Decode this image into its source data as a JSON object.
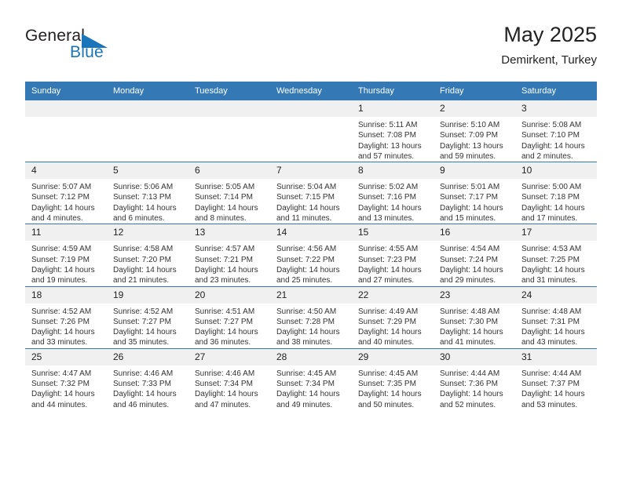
{
  "brand": {
    "name_part1": "General",
    "name_part2": "Blue",
    "accent_color": "#1b75bb",
    "triangle_icon": "triangle-right-icon"
  },
  "header": {
    "title": "May 2025",
    "subtitle": "Demirkent, Turkey"
  },
  "theme": {
    "header_bg": "#3478b5",
    "daynum_bg": "#f0f0f0",
    "grid_line": "#3478b5",
    "text": "#222222"
  },
  "weekday_headers": [
    "Sunday",
    "Monday",
    "Tuesday",
    "Wednesday",
    "Thursday",
    "Friday",
    "Saturday"
  ],
  "weeks": [
    [
      {
        "day": "",
        "sunrise": "",
        "sunset": "",
        "daylight_line1": "",
        "daylight_line2": ""
      },
      {
        "day": "",
        "sunrise": "",
        "sunset": "",
        "daylight_line1": "",
        "daylight_line2": ""
      },
      {
        "day": "",
        "sunrise": "",
        "sunset": "",
        "daylight_line1": "",
        "daylight_line2": ""
      },
      {
        "day": "",
        "sunrise": "",
        "sunset": "",
        "daylight_line1": "",
        "daylight_line2": ""
      },
      {
        "day": "1",
        "sunrise": "Sunrise: 5:11 AM",
        "sunset": "Sunset: 7:08 PM",
        "daylight_line1": "Daylight: 13 hours",
        "daylight_line2": "and 57 minutes."
      },
      {
        "day": "2",
        "sunrise": "Sunrise: 5:10 AM",
        "sunset": "Sunset: 7:09 PM",
        "daylight_line1": "Daylight: 13 hours",
        "daylight_line2": "and 59 minutes."
      },
      {
        "day": "3",
        "sunrise": "Sunrise: 5:08 AM",
        "sunset": "Sunset: 7:10 PM",
        "daylight_line1": "Daylight: 14 hours",
        "daylight_line2": "and 2 minutes."
      }
    ],
    [
      {
        "day": "4",
        "sunrise": "Sunrise: 5:07 AM",
        "sunset": "Sunset: 7:12 PM",
        "daylight_line1": "Daylight: 14 hours",
        "daylight_line2": "and 4 minutes."
      },
      {
        "day": "5",
        "sunrise": "Sunrise: 5:06 AM",
        "sunset": "Sunset: 7:13 PM",
        "daylight_line1": "Daylight: 14 hours",
        "daylight_line2": "and 6 minutes."
      },
      {
        "day": "6",
        "sunrise": "Sunrise: 5:05 AM",
        "sunset": "Sunset: 7:14 PM",
        "daylight_line1": "Daylight: 14 hours",
        "daylight_line2": "and 8 minutes."
      },
      {
        "day": "7",
        "sunrise": "Sunrise: 5:04 AM",
        "sunset": "Sunset: 7:15 PM",
        "daylight_line1": "Daylight: 14 hours",
        "daylight_line2": "and 11 minutes."
      },
      {
        "day": "8",
        "sunrise": "Sunrise: 5:02 AM",
        "sunset": "Sunset: 7:16 PM",
        "daylight_line1": "Daylight: 14 hours",
        "daylight_line2": "and 13 minutes."
      },
      {
        "day": "9",
        "sunrise": "Sunrise: 5:01 AM",
        "sunset": "Sunset: 7:17 PM",
        "daylight_line1": "Daylight: 14 hours",
        "daylight_line2": "and 15 minutes."
      },
      {
        "day": "10",
        "sunrise": "Sunrise: 5:00 AM",
        "sunset": "Sunset: 7:18 PM",
        "daylight_line1": "Daylight: 14 hours",
        "daylight_line2": "and 17 minutes."
      }
    ],
    [
      {
        "day": "11",
        "sunrise": "Sunrise: 4:59 AM",
        "sunset": "Sunset: 7:19 PM",
        "daylight_line1": "Daylight: 14 hours",
        "daylight_line2": "and 19 minutes."
      },
      {
        "day": "12",
        "sunrise": "Sunrise: 4:58 AM",
        "sunset": "Sunset: 7:20 PM",
        "daylight_line1": "Daylight: 14 hours",
        "daylight_line2": "and 21 minutes."
      },
      {
        "day": "13",
        "sunrise": "Sunrise: 4:57 AM",
        "sunset": "Sunset: 7:21 PM",
        "daylight_line1": "Daylight: 14 hours",
        "daylight_line2": "and 23 minutes."
      },
      {
        "day": "14",
        "sunrise": "Sunrise: 4:56 AM",
        "sunset": "Sunset: 7:22 PM",
        "daylight_line1": "Daylight: 14 hours",
        "daylight_line2": "and 25 minutes."
      },
      {
        "day": "15",
        "sunrise": "Sunrise: 4:55 AM",
        "sunset": "Sunset: 7:23 PM",
        "daylight_line1": "Daylight: 14 hours",
        "daylight_line2": "and 27 minutes."
      },
      {
        "day": "16",
        "sunrise": "Sunrise: 4:54 AM",
        "sunset": "Sunset: 7:24 PM",
        "daylight_line1": "Daylight: 14 hours",
        "daylight_line2": "and 29 minutes."
      },
      {
        "day": "17",
        "sunrise": "Sunrise: 4:53 AM",
        "sunset": "Sunset: 7:25 PM",
        "daylight_line1": "Daylight: 14 hours",
        "daylight_line2": "and 31 minutes."
      }
    ],
    [
      {
        "day": "18",
        "sunrise": "Sunrise: 4:52 AM",
        "sunset": "Sunset: 7:26 PM",
        "daylight_line1": "Daylight: 14 hours",
        "daylight_line2": "and 33 minutes."
      },
      {
        "day": "19",
        "sunrise": "Sunrise: 4:52 AM",
        "sunset": "Sunset: 7:27 PM",
        "daylight_line1": "Daylight: 14 hours",
        "daylight_line2": "and 35 minutes."
      },
      {
        "day": "20",
        "sunrise": "Sunrise: 4:51 AM",
        "sunset": "Sunset: 7:27 PM",
        "daylight_line1": "Daylight: 14 hours",
        "daylight_line2": "and 36 minutes."
      },
      {
        "day": "21",
        "sunrise": "Sunrise: 4:50 AM",
        "sunset": "Sunset: 7:28 PM",
        "daylight_line1": "Daylight: 14 hours",
        "daylight_line2": "and 38 minutes."
      },
      {
        "day": "22",
        "sunrise": "Sunrise: 4:49 AM",
        "sunset": "Sunset: 7:29 PM",
        "daylight_line1": "Daylight: 14 hours",
        "daylight_line2": "and 40 minutes."
      },
      {
        "day": "23",
        "sunrise": "Sunrise: 4:48 AM",
        "sunset": "Sunset: 7:30 PM",
        "daylight_line1": "Daylight: 14 hours",
        "daylight_line2": "and 41 minutes."
      },
      {
        "day": "24",
        "sunrise": "Sunrise: 4:48 AM",
        "sunset": "Sunset: 7:31 PM",
        "daylight_line1": "Daylight: 14 hours",
        "daylight_line2": "and 43 minutes."
      }
    ],
    [
      {
        "day": "25",
        "sunrise": "Sunrise: 4:47 AM",
        "sunset": "Sunset: 7:32 PM",
        "daylight_line1": "Daylight: 14 hours",
        "daylight_line2": "and 44 minutes."
      },
      {
        "day": "26",
        "sunrise": "Sunrise: 4:46 AM",
        "sunset": "Sunset: 7:33 PM",
        "daylight_line1": "Daylight: 14 hours",
        "daylight_line2": "and 46 minutes."
      },
      {
        "day": "27",
        "sunrise": "Sunrise: 4:46 AM",
        "sunset": "Sunset: 7:34 PM",
        "daylight_line1": "Daylight: 14 hours",
        "daylight_line2": "and 47 minutes."
      },
      {
        "day": "28",
        "sunrise": "Sunrise: 4:45 AM",
        "sunset": "Sunset: 7:34 PM",
        "daylight_line1": "Daylight: 14 hours",
        "daylight_line2": "and 49 minutes."
      },
      {
        "day": "29",
        "sunrise": "Sunrise: 4:45 AM",
        "sunset": "Sunset: 7:35 PM",
        "daylight_line1": "Daylight: 14 hours",
        "daylight_line2": "and 50 minutes."
      },
      {
        "day": "30",
        "sunrise": "Sunrise: 4:44 AM",
        "sunset": "Sunset: 7:36 PM",
        "daylight_line1": "Daylight: 14 hours",
        "daylight_line2": "and 52 minutes."
      },
      {
        "day": "31",
        "sunrise": "Sunrise: 4:44 AM",
        "sunset": "Sunset: 7:37 PM",
        "daylight_line1": "Daylight: 14 hours",
        "daylight_line2": "and 53 minutes."
      }
    ]
  ]
}
